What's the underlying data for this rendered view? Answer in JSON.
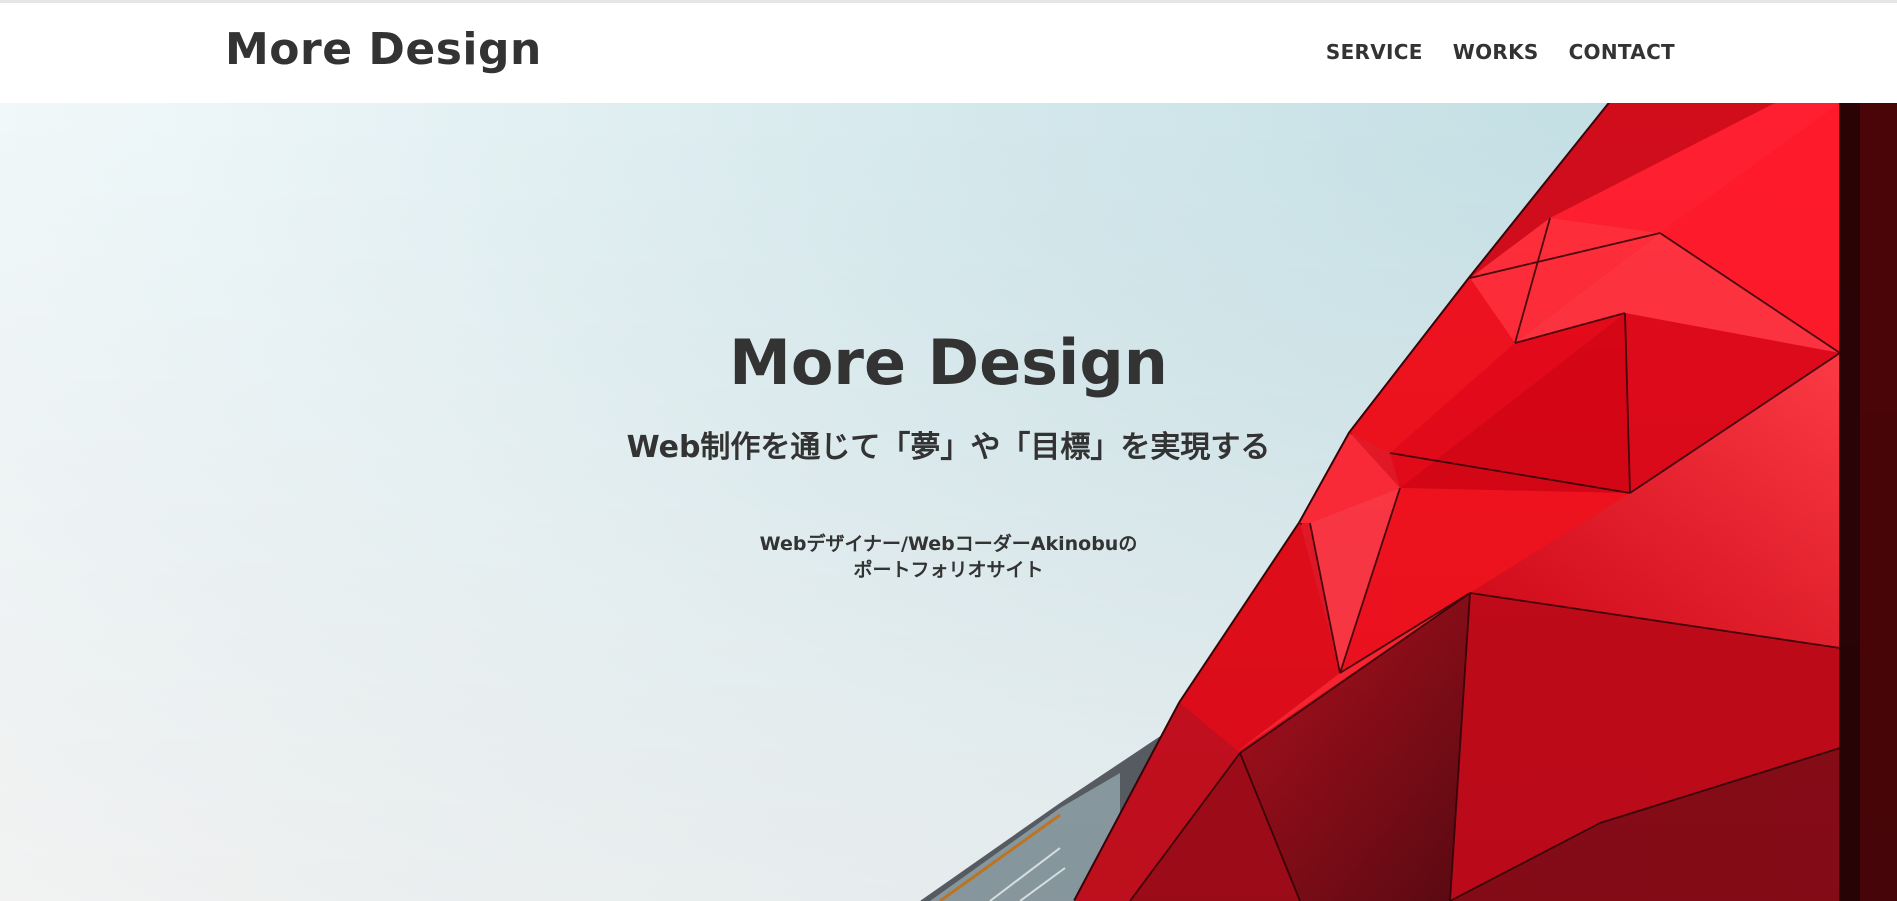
{
  "header": {
    "logo": "More Design",
    "nav": [
      {
        "label": "SERVICE"
      },
      {
        "label": "WORKS"
      },
      {
        "label": "CONTACT"
      }
    ]
  },
  "hero": {
    "title": "More Design",
    "subtitle": "Web制作を通じて「夢」や「目標」を実現する",
    "description_line1": "Webデザイナー/WebコーダーAkinobuの",
    "description_line2": "ポートフォリオサイト",
    "background_image": "red-geometric-building-facade",
    "colors": {
      "sky": "#c3dfe4",
      "red": "#e0101f",
      "dark_red": "#6a0a14",
      "text": "#333333"
    }
  }
}
